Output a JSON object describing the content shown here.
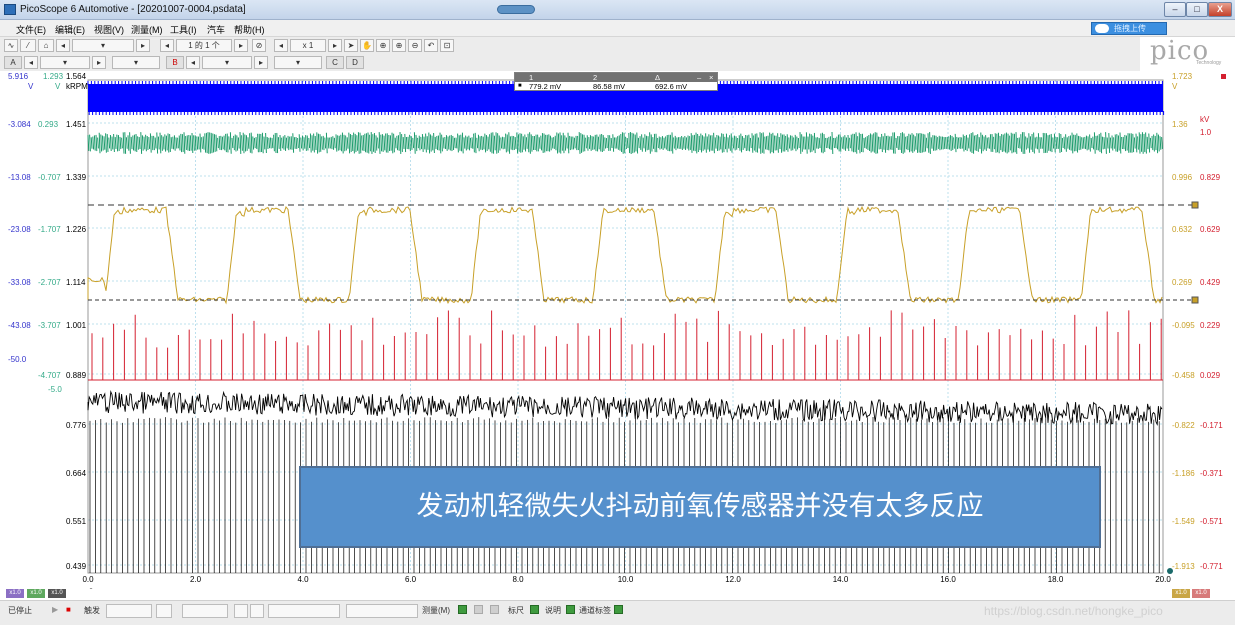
{
  "window": {
    "title": "PicoScope 6 Automotive - [20201007-0004.psdata]",
    "pill": "",
    "buttons": {
      "min": "–",
      "max": "□",
      "close": "X"
    }
  },
  "menu": [
    "文件(E)",
    "编辑(E)",
    "视图(V)",
    "测量(M)",
    "工具(I)",
    "汽车",
    "帮助(H)"
  ],
  "upload": {
    "label": "拖拽上传"
  },
  "logo": {
    "text": "pico",
    "sub": "Technology"
  },
  "toolbar1": {
    "page": "1 的 1 个",
    "zoom": "x 1"
  },
  "toolbar2": {
    "ch_a": "A",
    "ch_b": "B",
    "ch_c": "C",
    "ch_d": "D"
  },
  "scales": {
    "top": [
      "5.916",
      "1.293",
      "1.564"
    ],
    "top_units": [
      "V",
      "V",
      "kRPM"
    ],
    "right_top": "1.723",
    "right_unit": "V",
    "right_kv": "kV",
    "right_kv_val": "1.0",
    "rows": [
      [
        "-3.084",
        "0.293",
        "1.451",
        "1.36",
        ""
      ],
      [
        "-13.08",
        "-0.707",
        "1.339",
        "0.996",
        "0.829"
      ],
      [
        "-23.08",
        "-1.707",
        "1.226",
        "0.632",
        "0.629"
      ],
      [
        "-33.08",
        "-2.707",
        "1.114",
        "0.269",
        "0.429"
      ],
      [
        "-43.08",
        "-3.707",
        "1.001",
        "-0.095",
        "0.229"
      ],
      [
        "",
        "-4.707",
        "0.889",
        "-0.458",
        "0.029"
      ],
      [
        "",
        "",
        "0.776",
        "-0.822",
        "-0.171"
      ],
      [
        "",
        "",
        "0.664",
        "-1.186",
        "-0.371"
      ],
      [
        "",
        "",
        "0.551",
        "-1.549",
        "-0.571"
      ],
      [
        "",
        "",
        "0.439",
        "-1.913",
        "-0.771"
      ]
    ],
    "extra_left": [
      "-50.0",
      "-5.0"
    ],
    "x_ticks": [
      "0.0",
      "2.0",
      "4.0",
      "6.0",
      "8.0",
      "10.0",
      "12.0",
      "14.0",
      "16.0",
      "18.0",
      "20.0"
    ],
    "x_unit": "s"
  },
  "measurement": {
    "headers": [
      "1",
      "2",
      "Δ"
    ],
    "values": [
      "779.2 mV",
      "86.58 mV",
      "692.6 mV"
    ]
  },
  "banner": {
    "text": "发动机轻微失火抖动前氧传感器并没有太多反应"
  },
  "channels": {
    "left": [
      {
        "label": "x1.0",
        "color": "#8b6fc4"
      },
      {
        "label": "x1.0",
        "color": "#5ea85e"
      },
      {
        "label": "x1.0",
        "color": "#555555"
      }
    ],
    "right": [
      {
        "label": "x1.0",
        "color": "#c9a646"
      },
      {
        "label": "x1.0",
        "color": "#d77a7a"
      }
    ]
  },
  "status": {
    "stopped": "已停止",
    "trigger": "触发",
    "measure": "测量(M)",
    "ruler": "标尺",
    "notes": "说明",
    "channel_tags": "通道标签"
  },
  "watermark": "https://blog.csdn.net/hongke_pico",
  "colors": {
    "blue": "#0000ff",
    "green": "#1a9a6a",
    "gold": "#c8a028",
    "red": "#d42030",
    "black": "#000000"
  }
}
